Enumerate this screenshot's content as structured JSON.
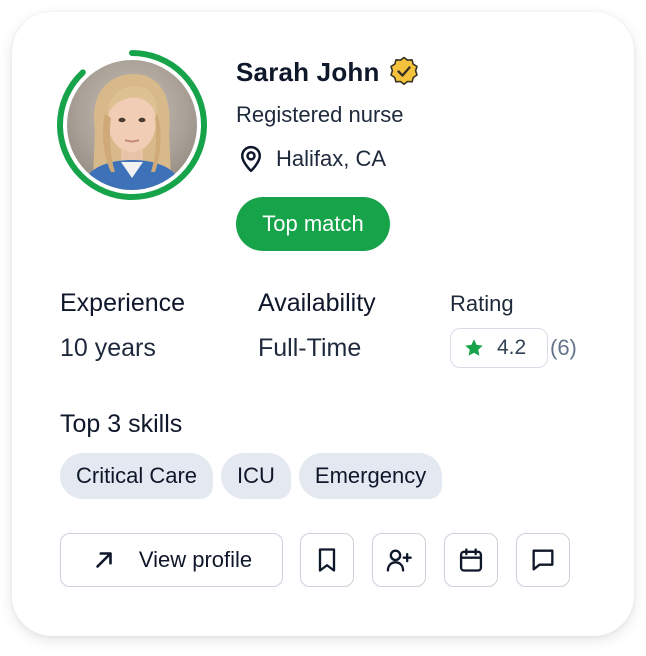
{
  "profile": {
    "name": "Sarah John",
    "role": "Registered nurse",
    "location": "Halifax, CA",
    "badge": "Top match",
    "match_progress": 0.88
  },
  "stats": {
    "experience_label": "Experience",
    "experience_value": "10 years",
    "availability_label": "Availability",
    "availability_value": "Full-Time",
    "rating_label": "Rating",
    "rating_value": "4.2",
    "rating_count": "(6)"
  },
  "skills": {
    "title": "Top 3 skills",
    "items": [
      "Critical Care",
      "ICU",
      "Emergency"
    ]
  },
  "actions": {
    "view_profile_label": "View profile",
    "icons": [
      "arrow-up-right-icon",
      "bookmark-icon",
      "user-plus-icon",
      "calendar-icon",
      "message-icon"
    ]
  },
  "colors": {
    "accent": "#16a34a",
    "chip_bg": "#e4e9f1",
    "verified_gold": "#f5c33b"
  }
}
